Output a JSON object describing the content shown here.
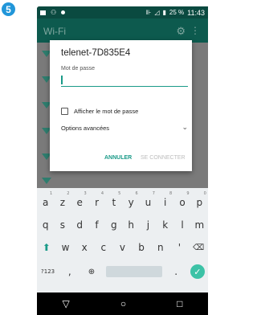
{
  "step_number": "5",
  "status_bar": {
    "battery_percent": "25 %",
    "time": "11:43"
  },
  "app_bar": {
    "title": "Wi-Fi"
  },
  "dialog": {
    "network_name": "telenet-7D835E4",
    "password_label": "Mot de passe",
    "password_value": "",
    "show_password_label": "Afficher le mot de passe",
    "show_password_checked": false,
    "advanced_options_label": "Options avancées",
    "cancel_button": "ANNULER",
    "connect_button": "SE CONNECTER"
  },
  "keyboard": {
    "row1": [
      {
        "key": "a",
        "num": "1"
      },
      {
        "key": "z",
        "num": "2"
      },
      {
        "key": "e",
        "num": "3"
      },
      {
        "key": "r",
        "num": "4"
      },
      {
        "key": "t",
        "num": "5"
      },
      {
        "key": "y",
        "num": "6"
      },
      {
        "key": "u",
        "num": "7"
      },
      {
        "key": "i",
        "num": "8"
      },
      {
        "key": "o",
        "num": "9"
      },
      {
        "key": "p",
        "num": "0"
      }
    ],
    "row2": [
      "q",
      "s",
      "d",
      "f",
      "g",
      "h",
      "j",
      "k",
      "l",
      "m"
    ],
    "row3": [
      "w",
      "x",
      "c",
      "v",
      "b",
      "n",
      "'"
    ],
    "symbols_key": "?123",
    "comma_key": ","
  },
  "accent_color": "#1a9a88"
}
